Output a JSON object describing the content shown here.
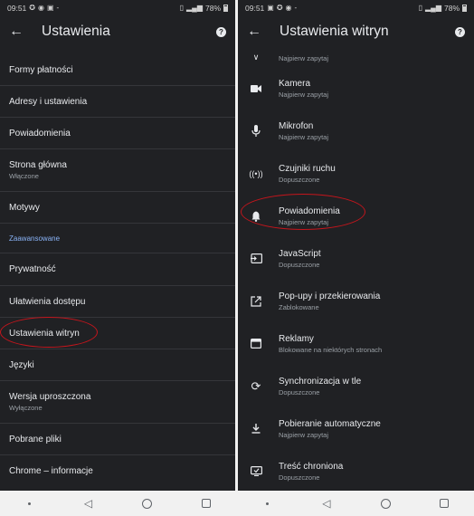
{
  "status_left": {
    "time": "09:51",
    "right_pct": "78%"
  },
  "status_right": {
    "time": "09:51",
    "right_pct": "78%"
  },
  "left_screen": {
    "title": "Ustawienia",
    "items": [
      {
        "title": "Formy płatności",
        "subtitle": ""
      },
      {
        "title": "Adresy i ustawienia",
        "subtitle": ""
      },
      {
        "title": "Powiadomienia",
        "subtitle": ""
      },
      {
        "title": "Strona główna",
        "subtitle": "Włączone"
      },
      {
        "title": "Motywy",
        "subtitle": ""
      }
    ],
    "section_label": "Zaawansowane",
    "items_advanced": [
      {
        "title": "Prywatność",
        "subtitle": ""
      },
      {
        "title": "Ułatwienia dostępu",
        "subtitle": ""
      },
      {
        "title": "Ustawienia witryn",
        "subtitle": ""
      },
      {
        "title": "Języki",
        "subtitle": ""
      },
      {
        "title": "Wersja uproszczona",
        "subtitle": "Wyłączone"
      },
      {
        "title": "Pobrane pliki",
        "subtitle": ""
      },
      {
        "title": "Chrome – informacje",
        "subtitle": ""
      }
    ]
  },
  "right_screen": {
    "title": "Ustawienia witryn",
    "partial_item": {
      "subtitle": "Najpierw zapytaj"
    },
    "items": [
      {
        "icon": "camera-icon",
        "title": "Kamera",
        "subtitle": "Najpierw zapytaj"
      },
      {
        "icon": "microphone-icon",
        "title": "Mikrofon",
        "subtitle": "Najpierw zapytaj"
      },
      {
        "icon": "motion-sensors-icon",
        "title": "Czujniki ruchu",
        "subtitle": "Dopuszczone"
      },
      {
        "icon": "bell-icon",
        "title": "Powiadomienia",
        "subtitle": "Najpierw zapytaj"
      },
      {
        "icon": "javascript-icon",
        "title": "JavaScript",
        "subtitle": "Dopuszczone"
      },
      {
        "icon": "popup-icon",
        "title": "Pop-upy i przekierowania",
        "subtitle": "Zablokowane"
      },
      {
        "icon": "ads-icon",
        "title": "Reklamy",
        "subtitle": "Blokowane na niektórych stronach"
      },
      {
        "icon": "sync-icon",
        "title": "Synchronizacja w tle",
        "subtitle": "Dopuszczone"
      },
      {
        "icon": "download-icon",
        "title": "Pobieranie automatyczne",
        "subtitle": "Najpierw zapytaj"
      },
      {
        "icon": "protected-content-icon",
        "title": "Treść chroniona",
        "subtitle": "Dopuszczone"
      }
    ]
  },
  "colors": {
    "background": "#202124",
    "text": "#e8eaed",
    "subtext": "#9aa0a6",
    "accent": "#8ab4f8",
    "annotation": "#c4151c"
  }
}
